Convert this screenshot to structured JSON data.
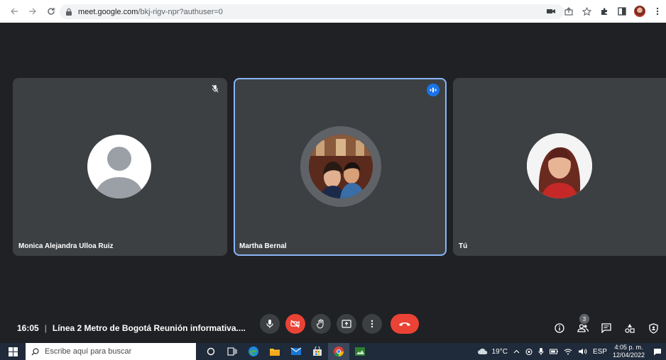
{
  "browser": {
    "url_host": "meet.google.com",
    "url_path": "/bkj-rigv-npr?authuser=0",
    "icons": [
      "back-icon",
      "forward-icon",
      "reload-icon",
      "lock-icon",
      "camera-in-use-icon",
      "share-icon",
      "star-icon",
      "extensions-icon",
      "sidepanel-icon",
      "profile-avatar",
      "menu-icon"
    ]
  },
  "tiles": [
    {
      "name": "Monica Alejandra Ulloa Ruiz",
      "muted": true
    },
    {
      "name": "Martha Bernal",
      "speaking": true
    },
    {
      "name": "Tú"
    }
  ],
  "meeting": {
    "time": "16:05",
    "separator": "|",
    "title": "Línea 2 Metro de Bogotá Reunión informativa...."
  },
  "controls": [
    "mic-button",
    "camera-off-button",
    "raise-hand-button",
    "present-button",
    "more-options-button",
    "leave-call-button"
  ],
  "right_controls": {
    "participants_count": "3",
    "items": [
      "info-button",
      "people-button",
      "chat-button",
      "activities-button",
      "host-controls-button"
    ]
  },
  "taskbar": {
    "search_placeholder": "Escribe aquí para buscar",
    "weather": "19°C",
    "language": "ESP",
    "time": "4:05 p. m.",
    "date": "12/04/2022"
  },
  "colors": {
    "stage_bg": "#202124",
    "tile_bg": "#3c4043",
    "active_border": "#8ab4f8",
    "danger": "#ea4335",
    "speaking_badge": "#1a73e8"
  }
}
